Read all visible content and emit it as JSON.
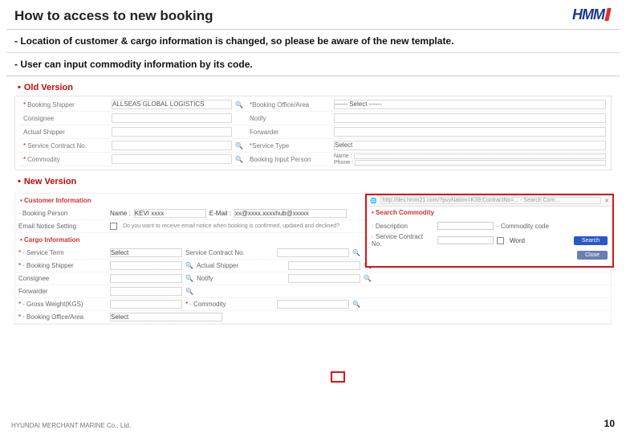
{
  "header": {
    "title": "How to access to new booking",
    "logo_text": "HMM"
  },
  "notes": [
    "-  Location of customer & cargo information is changed, so please be aware of the new template.",
    "-  User can input commodity information by its code."
  ],
  "section_labels": {
    "old": "Old Version",
    "new": "New Version"
  },
  "old_version": {
    "booking_shipper_label": "Booking Shipper",
    "booking_shipper_value": "ALLSEAS GLOBAL LOGISTICS",
    "booking_office_label": "Booking Office/Area",
    "booking_office_value": "------ Select ------",
    "consignee_label": "Consignee",
    "notify_label": "Notify",
    "actual_shipper_label": "Actual Shipper",
    "forwarder_label": "Forwarder",
    "svc_contract_label": "Service Contract No.",
    "svc_type_label": "Service Type",
    "svc_type_value": "Select",
    "commodity_label": "Commodity",
    "booking_input_person": "Booking Input Person",
    "name_label": "Name :",
    "phone_label": "Phone :"
  },
  "new_version": {
    "customer_info_header": "Customer Information",
    "booking_person_label": "Booking Person",
    "name_label": "Name :",
    "name_value": "KEVI xxxx",
    "email_label": "E-Mail :",
    "email_value": "xx@xxxx.xxxxhub@xxxxx",
    "email_notice_label": "Email Notice Setting",
    "email_notice_text": "Do you want to receive email notice when booking is confirmed, updated and declined?",
    "cargo_info_header": "Cargo Information",
    "service_term_label": "Service Term",
    "service_term_value": "Select",
    "service_contract_label": "Service Contract No.",
    "booking_shipper_label": "Booking Shipper",
    "actual_shipper_label": "Actual Shipper",
    "consignee_label": "Consignee",
    "notify_label": "Notify",
    "forwarder_label": "Forwarder",
    "gross_weight_label": "Gross Weight(KGS)",
    "commodity_label": "Commodity",
    "booking_office_label": "Booking Office/Area",
    "booking_office_value": "Select"
  },
  "popup": {
    "url": "http://dev.hmm21.com/?pvyNation=K39;ContractNo=... - Search Com...",
    "title": "Search Commodity",
    "description_label": "Description",
    "commodity_code_label": "Commodity code",
    "service_contract_label": "Service Contract No.",
    "word_label": "Word",
    "search_btn": "Search",
    "close_btn": "Close"
  },
  "footer": {
    "copyright": "HYUNDAI MERCHANT MARINE Co., Ltd.",
    "page_no": "10"
  }
}
